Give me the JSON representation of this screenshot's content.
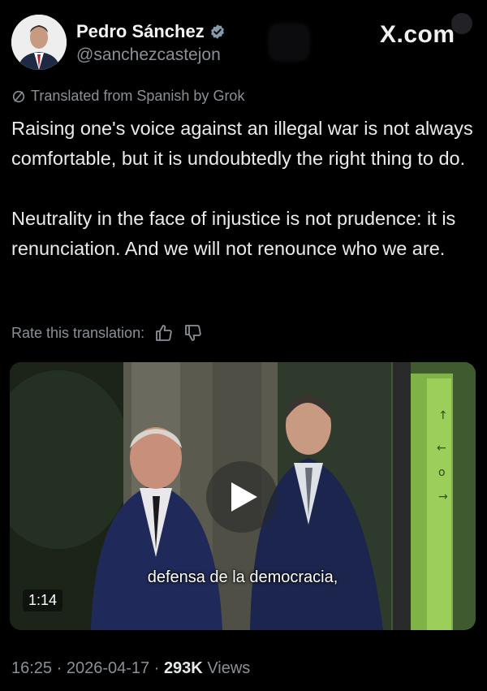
{
  "header": {
    "display_name": "Pedro Sánchez",
    "handle": "@sanchezcastejon",
    "brand": "X.com",
    "verified_icon": "verified-badge-icon"
  },
  "translation": {
    "label": "Translated from Spanish by Grok",
    "rate_label": "Rate this translation:"
  },
  "post": {
    "paragraph_1": "Raising one's voice against an illegal war is not always comfortable, but it is undoubtedly the right thing to do.",
    "paragraph_2": "Neutrality in the face of injustice is not prudence: it is renunciation. And we will not renounce who we are."
  },
  "video": {
    "subtitle": "defensa de la democracia,",
    "duration": "1:14"
  },
  "footer": {
    "time": "16:25",
    "date": "2026-04-17",
    "views_count": "293K",
    "views_label": "Views",
    "separator": " · "
  },
  "colors": {
    "background": "#000000",
    "text": "#e7e9ea",
    "secondary": "#8b9096",
    "verified": "#829aab"
  }
}
